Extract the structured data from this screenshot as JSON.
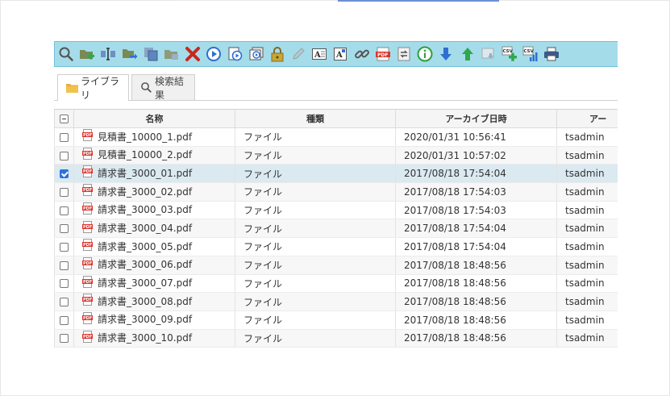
{
  "tabs": [
    {
      "label": "ライブラリ",
      "icon": "folder-icon",
      "active": true
    },
    {
      "label": "検索結果",
      "icon": "search-icon",
      "active": false
    }
  ],
  "columns": [
    "名称",
    "種類",
    "アーカイブ日時",
    "アー"
  ],
  "rows": [
    {
      "name": "見積書_10000_1.pdf",
      "type": "ファイル",
      "date": "2020/01/31 10:56:41",
      "user": "tsadmin",
      "checked": false
    },
    {
      "name": "見積書_10000_2.pdf",
      "type": "ファイル",
      "date": "2020/01/31 10:57:02",
      "user": "tsadmin",
      "checked": false
    },
    {
      "name": "請求書_3000_01.pdf",
      "type": "ファイル",
      "date": "2017/08/18 17:54:04",
      "user": "tsadmin",
      "checked": true
    },
    {
      "name": "請求書_3000_02.pdf",
      "type": "ファイル",
      "date": "2017/08/18 17:54:03",
      "user": "tsadmin",
      "checked": false
    },
    {
      "name": "請求書_3000_03.pdf",
      "type": "ファイル",
      "date": "2017/08/18 17:54:03",
      "user": "tsadmin",
      "checked": false
    },
    {
      "name": "請求書_3000_04.pdf",
      "type": "ファイル",
      "date": "2017/08/18 17:54:04",
      "user": "tsadmin",
      "checked": false
    },
    {
      "name": "請求書_3000_05.pdf",
      "type": "ファイル",
      "date": "2017/08/18 17:54:04",
      "user": "tsadmin",
      "checked": false
    },
    {
      "name": "請求書_3000_06.pdf",
      "type": "ファイル",
      "date": "2017/08/18 18:48:56",
      "user": "tsadmin",
      "checked": false
    },
    {
      "name": "請求書_3000_07.pdf",
      "type": "ファイル",
      "date": "2017/08/18 18:48:56",
      "user": "tsadmin",
      "checked": false
    },
    {
      "name": "請求書_3000_08.pdf",
      "type": "ファイル",
      "date": "2017/08/18 18:48:56",
      "user": "tsadmin",
      "checked": false
    },
    {
      "name": "請求書_3000_09.pdf",
      "type": "ファイル",
      "date": "2017/08/18 18:48:56",
      "user": "tsadmin",
      "checked": false
    },
    {
      "name": "請求書_3000_10.pdf",
      "type": "ファイル",
      "date": "2017/08/18 18:48:56",
      "user": "tsadmin",
      "checked": false
    }
  ],
  "toolbar": [
    "search-icon",
    "add-folder-icon",
    "rename-icon",
    "move-icon",
    "copy-icon",
    "paste-icon",
    "delete-icon",
    "play-icon",
    "play-document-icon",
    "play-slides-icon",
    "lock-icon",
    "edit-pen-icon",
    "text-annotation-icon",
    "text-stamp-icon",
    "link-icon",
    "pdf-icon",
    "convert-icon",
    "info-icon",
    "arrow-down-icon",
    "arrow-up-icon",
    "download-icon",
    "csv-add-icon",
    "csv-chart-icon",
    "print-icon"
  ],
  "colors": {
    "toolbar_bg": "#a5dcea",
    "selected_row": "#dbe9f1",
    "pdf_red": "#d9342b"
  }
}
